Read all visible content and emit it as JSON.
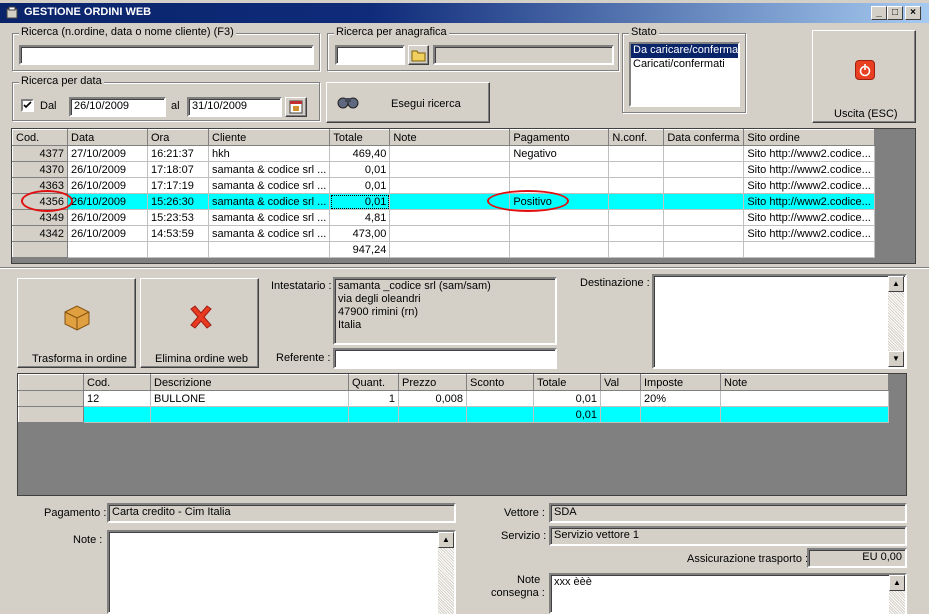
{
  "window": {
    "title": "GESTIONE ORDINI WEB",
    "controls": [
      "_",
      "□",
      "×"
    ]
  },
  "search": {
    "text_label": "Ricerca (n.ordine, data o nome cliente) (F3)",
    "text_value": "",
    "anagrafica_label": "Ricerca per anagrafica",
    "anagrafica_value": "",
    "anagrafica_desc": "",
    "date_label": "Ricerca per data",
    "dal_label": "Dal",
    "dal_checked": true,
    "from_date": "26/10/2009",
    "al_label": "al",
    "to_date": "31/10/2009",
    "run_label": "Esegui ricerca"
  },
  "stato": {
    "label": "Stato",
    "options": [
      "Da caricare/conferma",
      "Caricati/confermati"
    ],
    "selected": "Da caricare/conferma"
  },
  "exit": {
    "label": "Uscita (ESC)"
  },
  "orders": {
    "columns": [
      "Cod.",
      "Data",
      "Ora",
      "Cliente",
      "Totale",
      "Note",
      "Pagamento",
      "N.conf.",
      "Data conferma",
      "Sito ordine"
    ],
    "rows": [
      {
        "cod": "4377",
        "data": "27/10/2009",
        "ora": "16:21:37",
        "cliente": "hkh",
        "totale": "469,40",
        "note": "",
        "pagamento": "Negativo",
        "nconf": "",
        "dataconf": "",
        "sito": "Sito http://www2.codice..."
      },
      {
        "cod": "4370",
        "data": "26/10/2009",
        "ora": "17:18:07",
        "cliente": "samanta & codice srl ...",
        "totale": "0,01",
        "note": "",
        "pagamento": "",
        "nconf": "",
        "dataconf": "",
        "sito": "Sito http://www2.codice..."
      },
      {
        "cod": "4363",
        "data": "26/10/2009",
        "ora": "17:17:19",
        "cliente": "samanta & codice srl ...",
        "totale": "0,01",
        "note": "",
        "pagamento": "",
        "nconf": "",
        "dataconf": "",
        "sito": "Sito http://www2.codice..."
      },
      {
        "cod": "4356",
        "data": "26/10/2009",
        "ora": "15:26:30",
        "cliente": "samanta & codice srl ...",
        "totale": "0,01",
        "note": "",
        "pagamento": "Positivo",
        "nconf": "",
        "dataconf": "",
        "sito": "Sito http://www2.codice..."
      },
      {
        "cod": "4349",
        "data": "26/10/2009",
        "ora": "15:23:53",
        "cliente": "samanta & codice srl ...",
        "totale": "4,81",
        "note": "",
        "pagamento": "",
        "nconf": "",
        "dataconf": "",
        "sito": "Sito http://www2.codice..."
      },
      {
        "cod": "4342",
        "data": "26/10/2009",
        "ora": "14:53:59",
        "cliente": "samanta & codice srl ...",
        "totale": "473,00",
        "note": "",
        "pagamento": "",
        "nconf": "",
        "dataconf": "",
        "sito": "Sito http://www2.codice..."
      }
    ],
    "selected_cod": "4356",
    "total": "947,24"
  },
  "actions": {
    "transform_label": "Trasforma in ordine",
    "delete_label": "Elimina ordine web"
  },
  "intestatario": {
    "label": "Intestatario :",
    "lines": [
      "samanta _codice srl (sam/sam)",
      "via degli oleandri",
      "47900 rimini (rn)",
      "Italia"
    ]
  },
  "referente": {
    "label": "Referente :",
    "value": ""
  },
  "destinazione": {
    "label": "Destinazione :",
    "value": ""
  },
  "items": {
    "columns": [
      "Cod.",
      "Descrizione",
      "Quant.",
      "Prezzo",
      "Sconto",
      "Totale",
      "Val",
      "Imposte",
      "Note"
    ],
    "rows": [
      {
        "cod": "12",
        "descrizione": "BULLONE",
        "quant": "1",
        "prezzo": "0,008",
        "sconto": "",
        "totale": "0,01",
        "val": "",
        "imposte": "20%",
        "note": ""
      }
    ],
    "total": "0,01"
  },
  "footer": {
    "pagamento_label": "Pagamento :",
    "pagamento_value": "Carta credito - Cim Italia",
    "note_label": "Note :",
    "note_value": "",
    "vettore_label": "Vettore :",
    "vettore_value": "SDA",
    "servizio_label": "Servizio :",
    "servizio_value": "Servizio vettore 1",
    "assicurazione_label": "Assicurazione trasporto :",
    "assicurazione_value": "EU 0,00",
    "note_consegna_label_1": "Note",
    "note_consegna_label_2": "consegna :",
    "note_consegna_value": "xxx èèè"
  },
  "colors": {
    "selection": "#00ffff",
    "titlebar": "#0a246a",
    "highlight_ring": "#e01010",
    "list_selection": "#0a246a"
  }
}
